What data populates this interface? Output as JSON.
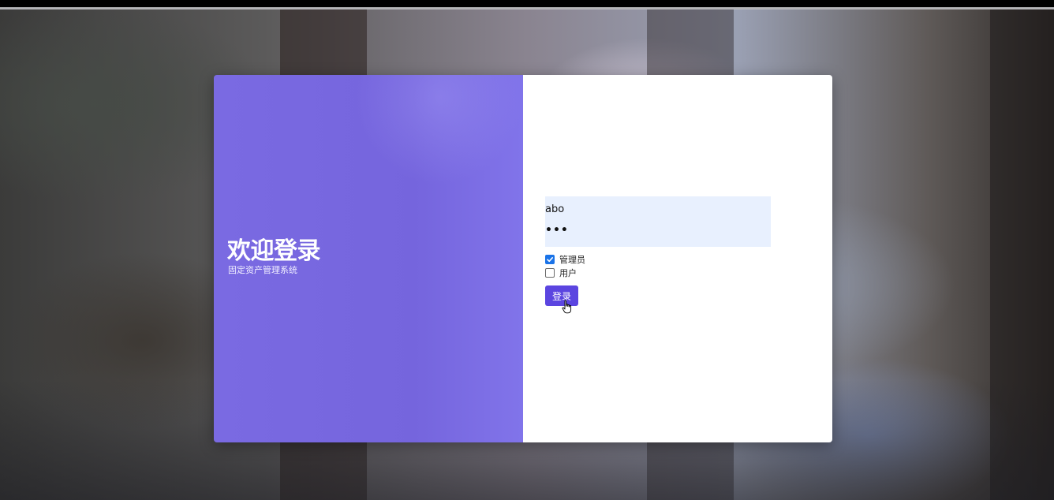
{
  "welcome": {
    "title": "欢迎登录",
    "subtitle": "固定资产管理系统"
  },
  "form": {
    "username_value": "abo",
    "password_value": "•••"
  },
  "roles": [
    {
      "label": "管理员",
      "checked": true
    },
    {
      "label": "用户",
      "checked": false
    }
  ],
  "login_button": "登录",
  "colors": {
    "panel": "#7565dd",
    "button": "#5b45e0",
    "autofill": "#e8f0fe",
    "checkbox": "#1a73e8"
  },
  "icons": {
    "cursor": "hand-pointer-cursor-icon",
    "check": "checkmark-icon"
  }
}
